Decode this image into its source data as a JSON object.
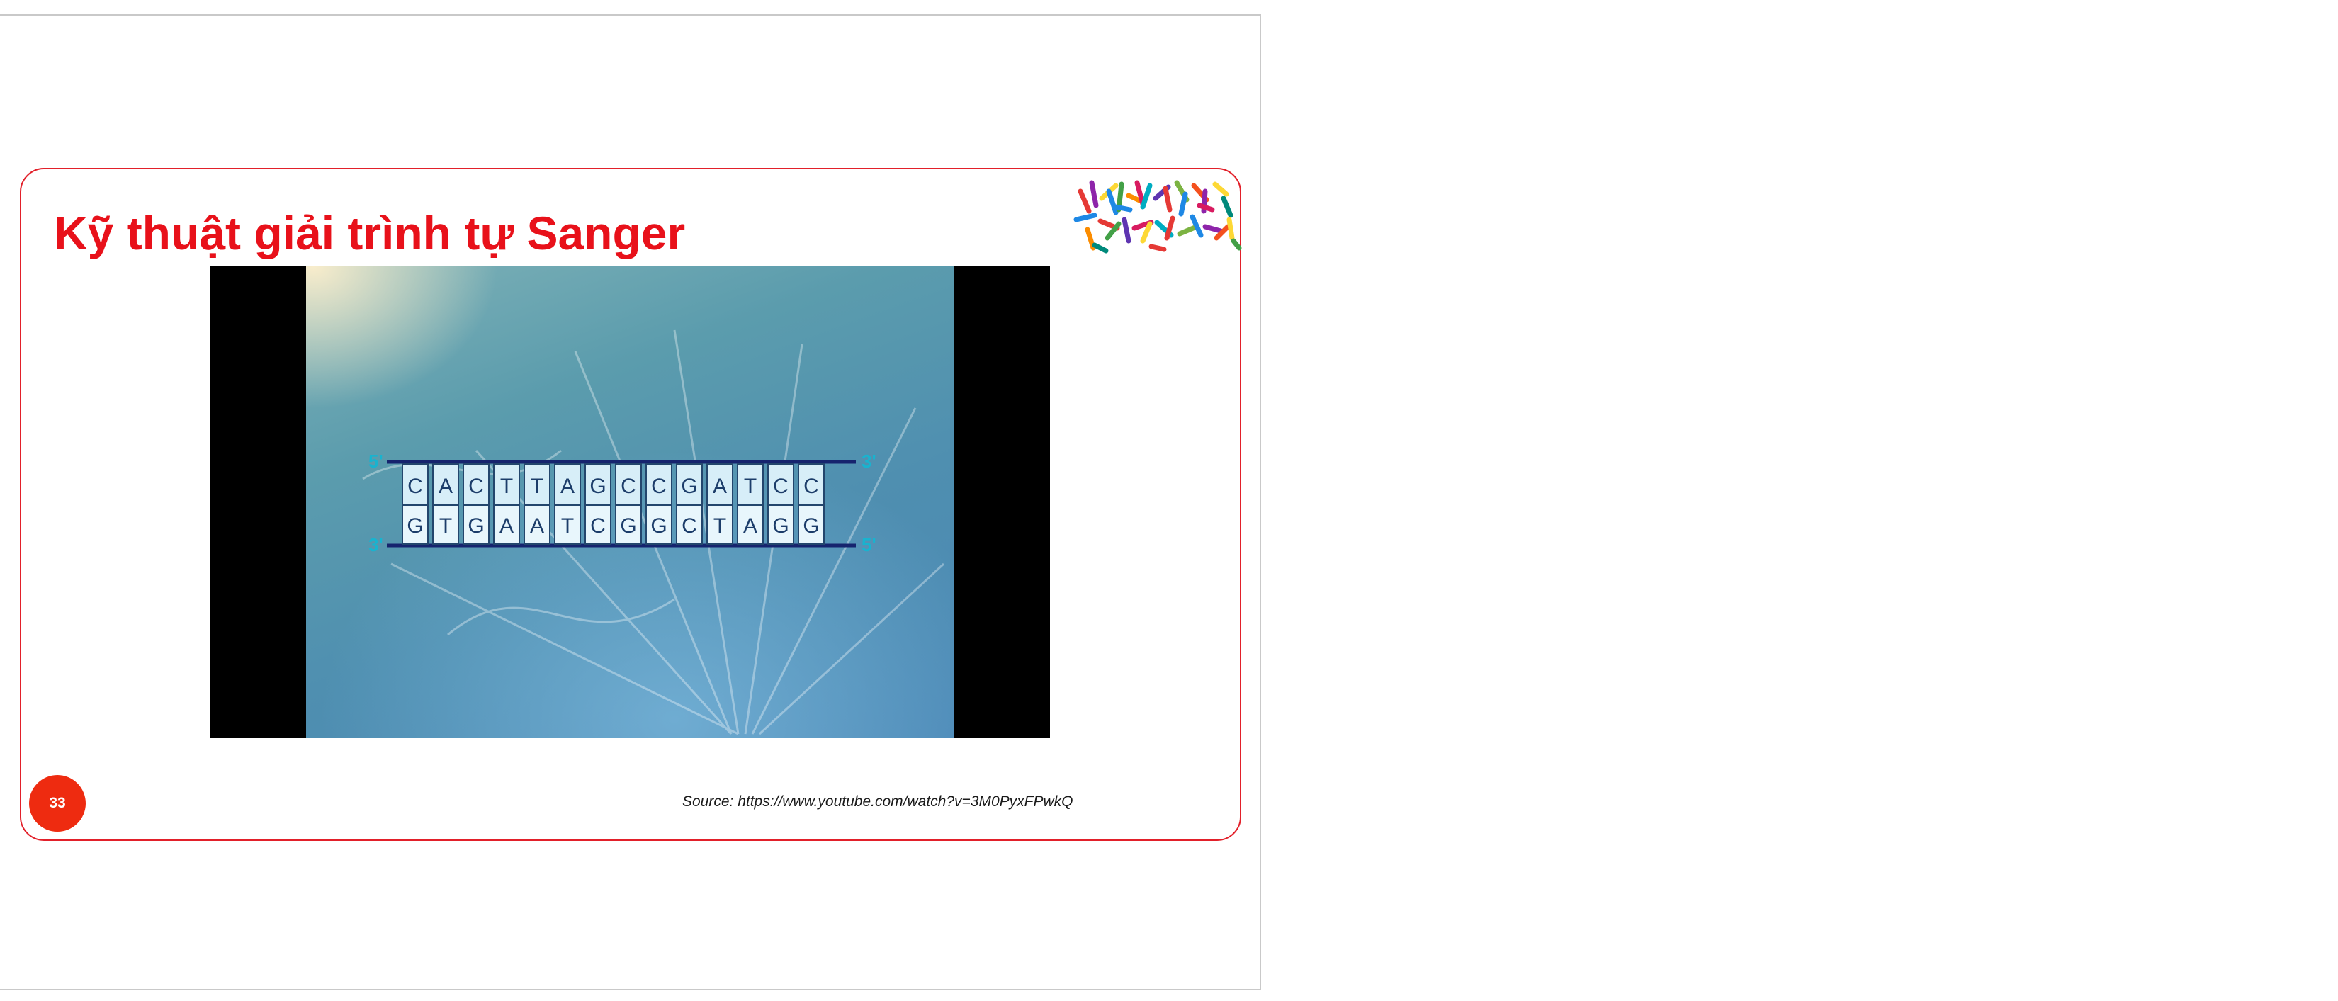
{
  "slide": {
    "title": "Kỹ thuật giải trình tự Sanger",
    "page_number": "33",
    "source": "Source: https://www.youtube.com/watch?v=3M0PyxFPwkQ"
  },
  "dna": {
    "label_top_left": "5'",
    "label_top_right": "3'",
    "label_bottom_left": "3'",
    "label_bottom_right": "5'",
    "top_strand": [
      "C",
      "A",
      "C",
      "T",
      "T",
      "A",
      "G",
      "C",
      "C",
      "G",
      "A",
      "T",
      "C",
      "C"
    ],
    "bottom_strand": [
      "G",
      "T",
      "G",
      "A",
      "A",
      "T",
      "C",
      "G",
      "G",
      "C",
      "T",
      "A",
      "G",
      "G"
    ]
  },
  "colors": {
    "title": "#e8111a",
    "slide_border": "#e2202a",
    "page_badge": "#ee2b10",
    "strand_line": "#16246e",
    "end_label": "#19b3cf"
  },
  "icons": {
    "decoration": "chromosomes-icon"
  }
}
